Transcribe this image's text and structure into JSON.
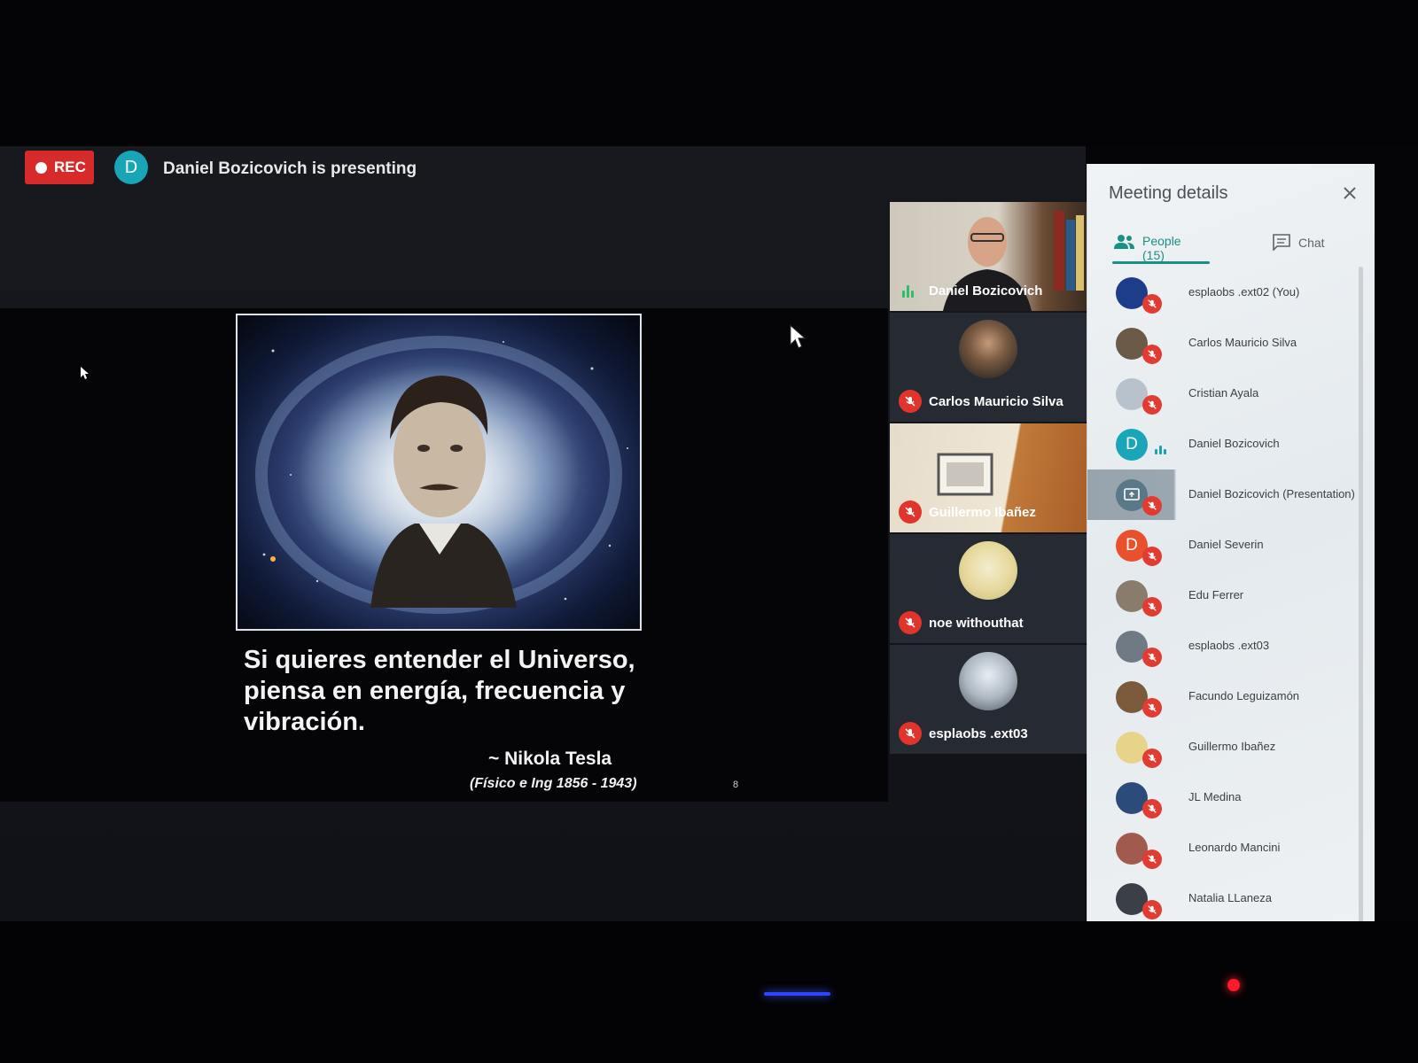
{
  "rec_label": "REC",
  "presenter": {
    "initial": "D",
    "status": "Daniel Bozicovich is presenting"
  },
  "slide": {
    "quote": "Si quieres entender el Universo, piensa en energía, frecuencia y vibración.",
    "attribution": "~ Nikola Tesla",
    "subtitle": "(Físico e Ing 1856 - 1943)",
    "page_number": "8"
  },
  "tiles": [
    {
      "name": "Daniel Bozicovich",
      "state": "speaking"
    },
    {
      "name": "Carlos Mauricio Silva",
      "state": "muted"
    },
    {
      "name": "Guillermo Ibañez",
      "state": "muted"
    },
    {
      "name": "noe withouthat",
      "state": "muted"
    },
    {
      "name": "esplaobs .ext03",
      "state": "muted"
    }
  ],
  "panel": {
    "title": "Meeting details",
    "tabs": {
      "people": "People (15)",
      "chat": "Chat"
    },
    "people": [
      {
        "name": "esplaobs .ext02 (You)",
        "initial": "",
        "avatar_color": "#1d3c8a",
        "state": "muted"
      },
      {
        "name": "Carlos Mauricio Silva",
        "initial": "",
        "avatar_color": "#6b5a48",
        "state": "muted"
      },
      {
        "name": "Cristian Ayala",
        "initial": "",
        "avatar_color": "#b8c2cc",
        "state": "muted"
      },
      {
        "name": "Daniel Bozicovich",
        "initial": "D",
        "avatar_color": "#1aa6b8",
        "state": "speaking"
      },
      {
        "name": "Daniel Bozicovich (Presentation)",
        "initial": "",
        "avatar_color": "#5a7888",
        "state": "muted"
      },
      {
        "name": "Daniel Severin",
        "initial": "D",
        "avatar_color": "#e8512c",
        "state": "muted"
      },
      {
        "name": "Edu Ferrer",
        "initial": "",
        "avatar_color": "#8a7c6c",
        "state": "muted"
      },
      {
        "name": "esplaobs .ext03",
        "initial": "",
        "avatar_color": "#6f7a84",
        "state": "muted"
      },
      {
        "name": "Facundo Leguizamón",
        "initial": "",
        "avatar_color": "#7a5a3a",
        "state": "muted"
      },
      {
        "name": "Guillermo Ibañez",
        "initial": "",
        "avatar_color": "#e8d38a",
        "state": "muted"
      },
      {
        "name": "JL Medina",
        "initial": "",
        "avatar_color": "#2b4c7a",
        "state": "muted"
      },
      {
        "name": "Leonardo Mancini",
        "initial": "",
        "avatar_color": "#a05a4e",
        "state": "muted"
      },
      {
        "name": "Natalia LLaneza",
        "initial": "",
        "avatar_color": "#3a3f48",
        "state": "muted"
      }
    ]
  }
}
